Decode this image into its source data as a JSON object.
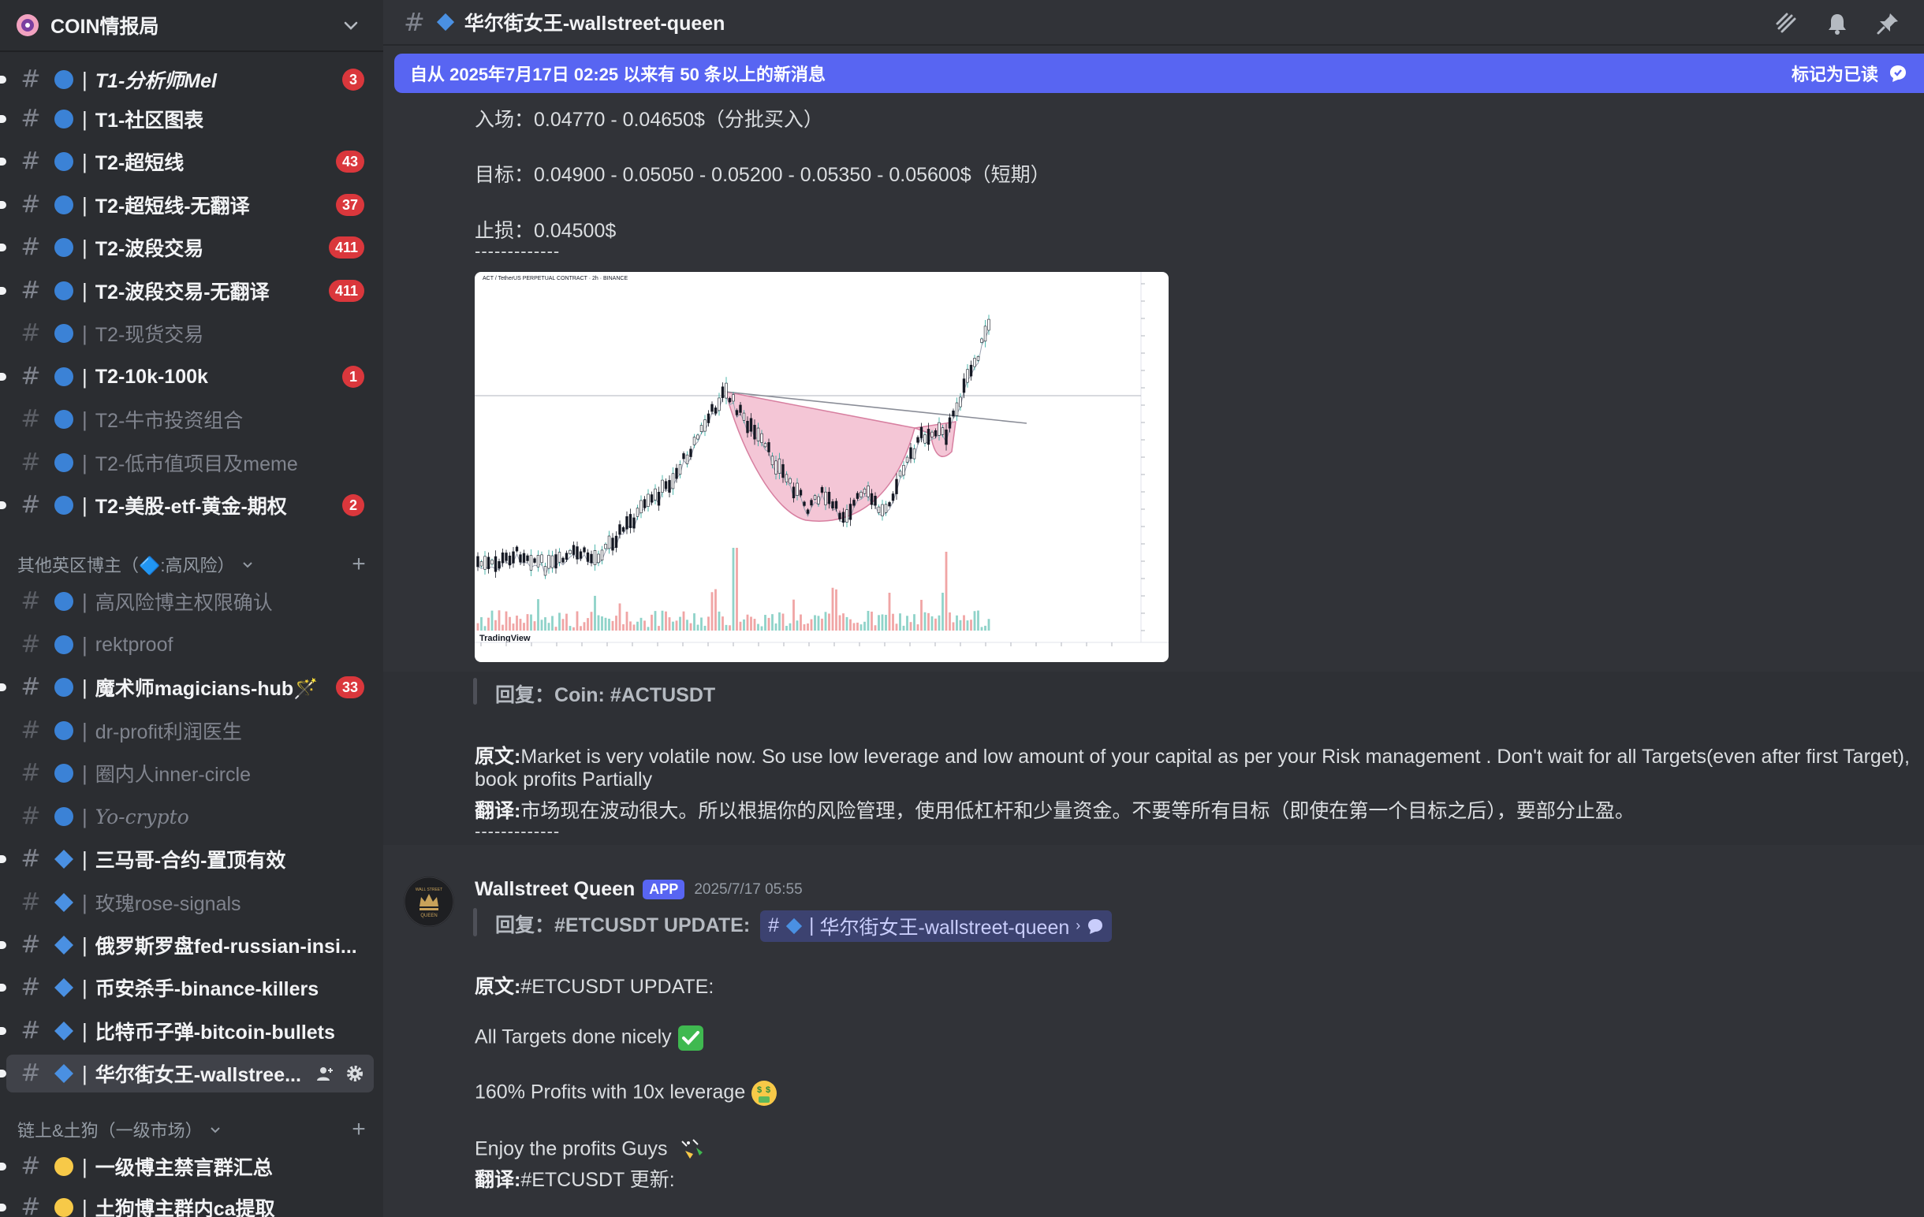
{
  "server": {
    "name": "COIN情报局"
  },
  "channels": [
    {
      "name": "T1-分析师Mel",
      "badge": "3"
    },
    {
      "name": "T1-社区图表",
      "badge": ""
    },
    {
      "name": "T2-超短线",
      "badge": "43"
    },
    {
      "name": "T2-超短线-无翻译",
      "badge": "37"
    },
    {
      "name": "T2-波段交易",
      "badge": "411"
    },
    {
      "name": "T2-波段交易-无翻译",
      "badge": "411"
    },
    {
      "name": "T2-现货交易",
      "badge": ""
    },
    {
      "name": "T2-10k-100k",
      "badge": "1"
    },
    {
      "name": "T2-牛市投资组合",
      "badge": ""
    },
    {
      "name": "T2-低市值项目及meme",
      "badge": ""
    },
    {
      "name": "T2-美股-etf-黄金-期权",
      "badge": "2"
    }
  ],
  "category1": {
    "label": "其他英区博主（🔷:高风险）"
  },
  "channels2": [
    {
      "name": "高风险博主权限确认",
      "badge": ""
    },
    {
      "name": "rektproof",
      "badge": ""
    },
    {
      "name": "魔术师magicians-hub🪄",
      "badge": "33"
    },
    {
      "name": "dr-profit利润医生",
      "badge": ""
    },
    {
      "name": "圈内人inner-circle",
      "badge": ""
    },
    {
      "name": "Yo-crypto",
      "badge": ""
    },
    {
      "name": "三马哥-合约-置顶有效",
      "badge": ""
    },
    {
      "name": "玫瑰rose-signals",
      "badge": ""
    },
    {
      "name": "俄罗斯罗盘fed-russian-insi...",
      "badge": ""
    },
    {
      "name": "币安杀手-binance-killers",
      "badge": ""
    },
    {
      "name": "比特币子弹-bitcoin-bullets",
      "badge": ""
    },
    {
      "name": "华尔街女王-wallstree...",
      "badge": ""
    }
  ],
  "category2": {
    "label": "链上&土狗（一级市场）"
  },
  "channels3": [
    {
      "name": "一级博主禁言群汇总",
      "badge": ""
    },
    {
      "name": "土狗博主群内ca提取",
      "badge": ""
    }
  ],
  "header": {
    "title": "华尔街女王-wallstreet-queen"
  },
  "banner": {
    "text": "自从 2025年7月17日 02:25 以来有 50 条以上的新消息",
    "mark_read": "标记为已读"
  },
  "msg1": {
    "entry": "入场：0.04770 - 0.04650$（分批买入）",
    "target": "目标：0.04900 - 0.05050 - 0.05200 - 0.05350 - 0.05600$（短期）",
    "stop": "止损：0.04500$",
    "divider": "-------------",
    "chart_title": "ACT / TetherUS PERPETUAL CONTRACT · 2h · BINANCE",
    "chart_brand": "TradingView",
    "reply_prefix": "回复：",
    "reply_body": "Coin: #ACTUSDT",
    "orig_label": "原文:",
    "orig_text": "Market is very volatile now. So use low leverage and low amount of your capital as per your Risk management . Don't wait for all Targets(even after first Target),",
    "orig_text2": "book profits Partially",
    "trans_label": "翻译:",
    "trans_text": "市场现在波动很大。所以根据你的风险管理，使用低杠杆和少量资金。不要等所有目标（即使在第一个目标之后），要部分止盈。",
    "divider2": "-------------"
  },
  "msg2": {
    "author": "Wallstreet Queen",
    "tag": "APP",
    "time": "2025/7/17 05:55",
    "reply_prefix": "回复：",
    "reply_body": "#ETCUSDT UPDATE:",
    "mention": "华尔街女王-wallstreet-queen",
    "orig_label": "原文:",
    "orig_text": "#ETCUSDT UPDATE:",
    "line1": "All Targets done nicely",
    "line2": "160% Profits with 10x leverage",
    "line3": "Enjoy the profits Guys",
    "trans_label": "翻译:",
    "trans_text": "#ETCUSDT 更新:"
  },
  "colors": {
    "accent": "#5865f2",
    "badge": "#da373c",
    "blue_dot": "#3b82d6",
    "blue_diamond": "#4a90e2",
    "yellow_dot": "#f7c948"
  }
}
